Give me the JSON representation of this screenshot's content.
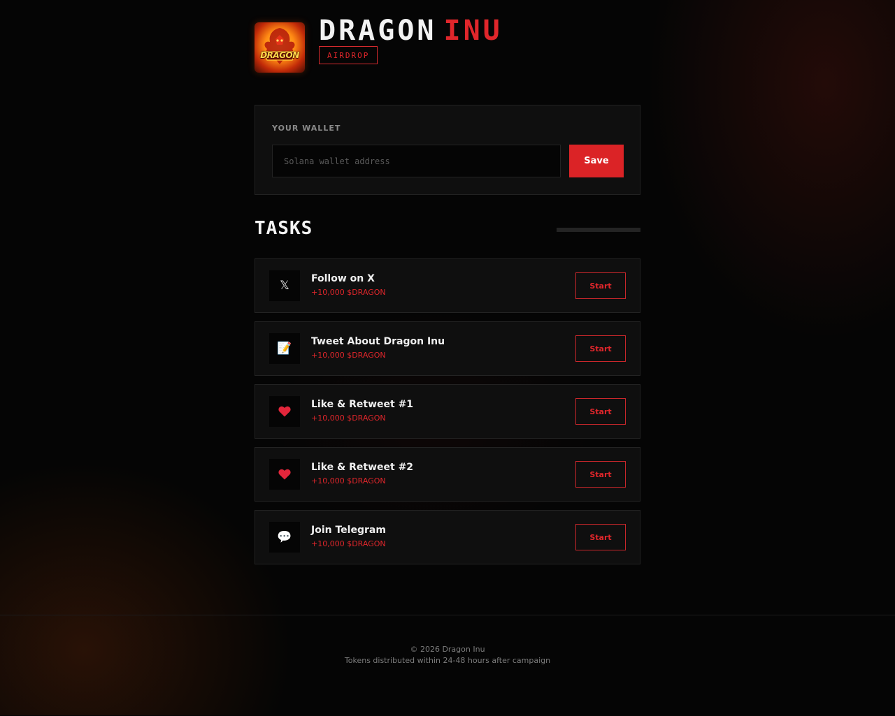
{
  "header": {
    "brand_first": "DRAGON",
    "brand_second": "INU",
    "badge": "AIRDROP",
    "logo_text": "DRAGON"
  },
  "wallet": {
    "label": "YOUR WALLET",
    "placeholder": "Solana wallet address",
    "value": "",
    "save_label": "Save"
  },
  "tasks": {
    "title": "TASKS",
    "progress_fraction": 0,
    "items": [
      {
        "icon": "x-logo-icon",
        "glyph": "𝕏",
        "name": "Follow on X",
        "reward": "+10,000 $DRAGON",
        "button": "Start"
      },
      {
        "icon": "memo-icon",
        "glyph": "📝",
        "name": "Tweet About Dragon Inu",
        "reward": "+10,000 $DRAGON",
        "button": "Start"
      },
      {
        "icon": "heart-icon",
        "glyph": "",
        "name": "Like & Retweet #1",
        "reward": "+10,000 $DRAGON",
        "button": "Start"
      },
      {
        "icon": "heart-icon",
        "glyph": "",
        "name": "Like & Retweet #2",
        "reward": "+10,000 $DRAGON",
        "button": "Start"
      },
      {
        "icon": "speech-bubble-icon",
        "glyph": "💬",
        "name": "Join Telegram",
        "reward": "+10,000 $DRAGON",
        "button": "Start"
      }
    ]
  },
  "footer": {
    "copyright": "© 2026 Dragon Inu",
    "note": "Tokens distributed within 24-48 hours after campaign"
  },
  "colors": {
    "accent": "#db2326",
    "background": "#050505",
    "card": "#0f0f0f"
  }
}
